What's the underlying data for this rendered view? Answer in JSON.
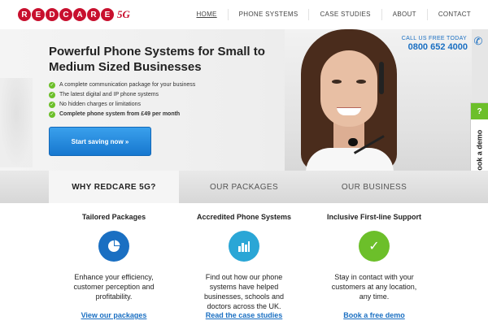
{
  "logo": {
    "letters": [
      "R",
      "E",
      "D",
      "C",
      "A",
      "R",
      "E"
    ],
    "suffix": "5G"
  },
  "nav": {
    "items": [
      {
        "label": "HOME",
        "active": true
      },
      {
        "label": "PHONE SYSTEMS"
      },
      {
        "label": "CASE STUDIES"
      },
      {
        "label": "ABOUT"
      },
      {
        "label": "CONTACT"
      }
    ]
  },
  "hero": {
    "title": "Powerful Phone Systems for Small to Medium Sized Businesses",
    "bullets": [
      "A complete communication package for your business",
      "The latest digital and IP phone systems",
      "No hidden charges or limitations",
      "Complete phone system from £49 per month"
    ],
    "cta_label": "Start saving now »"
  },
  "call": {
    "label": "CALL US FREE TODAY",
    "number": "0800 652 4000",
    "icon": "phone-icon"
  },
  "demo_tab": {
    "icon_glyph": "?",
    "label": "Book a demo"
  },
  "tabs": [
    {
      "label": "WHY REDCARE 5G?",
      "active": true
    },
    {
      "label": "OUR PACKAGES"
    },
    {
      "label": "OUR BUSINESS"
    }
  ],
  "features": [
    {
      "title": "Tailored Packages",
      "icon": "pie-chart-icon",
      "icon_color": "#1a6fc2",
      "description": "Enhance your efficiency, customer perception and profitability.",
      "link": "View our packages"
    },
    {
      "title": "Accredited Phone Systems",
      "icon": "bar-chart-icon",
      "icon_color": "#2aa6d6",
      "description": "Find out how our phone systems have helped businesses, schools and doctors across the UK.",
      "link": "Read the case studies"
    },
    {
      "title": "Inclusive First-line Support",
      "icon": "check-icon",
      "icon_color": "#6cbf2a",
      "description": "Stay in contact with your customers at any location, any time.",
      "link": "Book a free demo"
    }
  ],
  "colors": {
    "brand_red": "#c8102e",
    "brand_blue": "#1a6fc2",
    "accent_green": "#6cbf2a"
  }
}
